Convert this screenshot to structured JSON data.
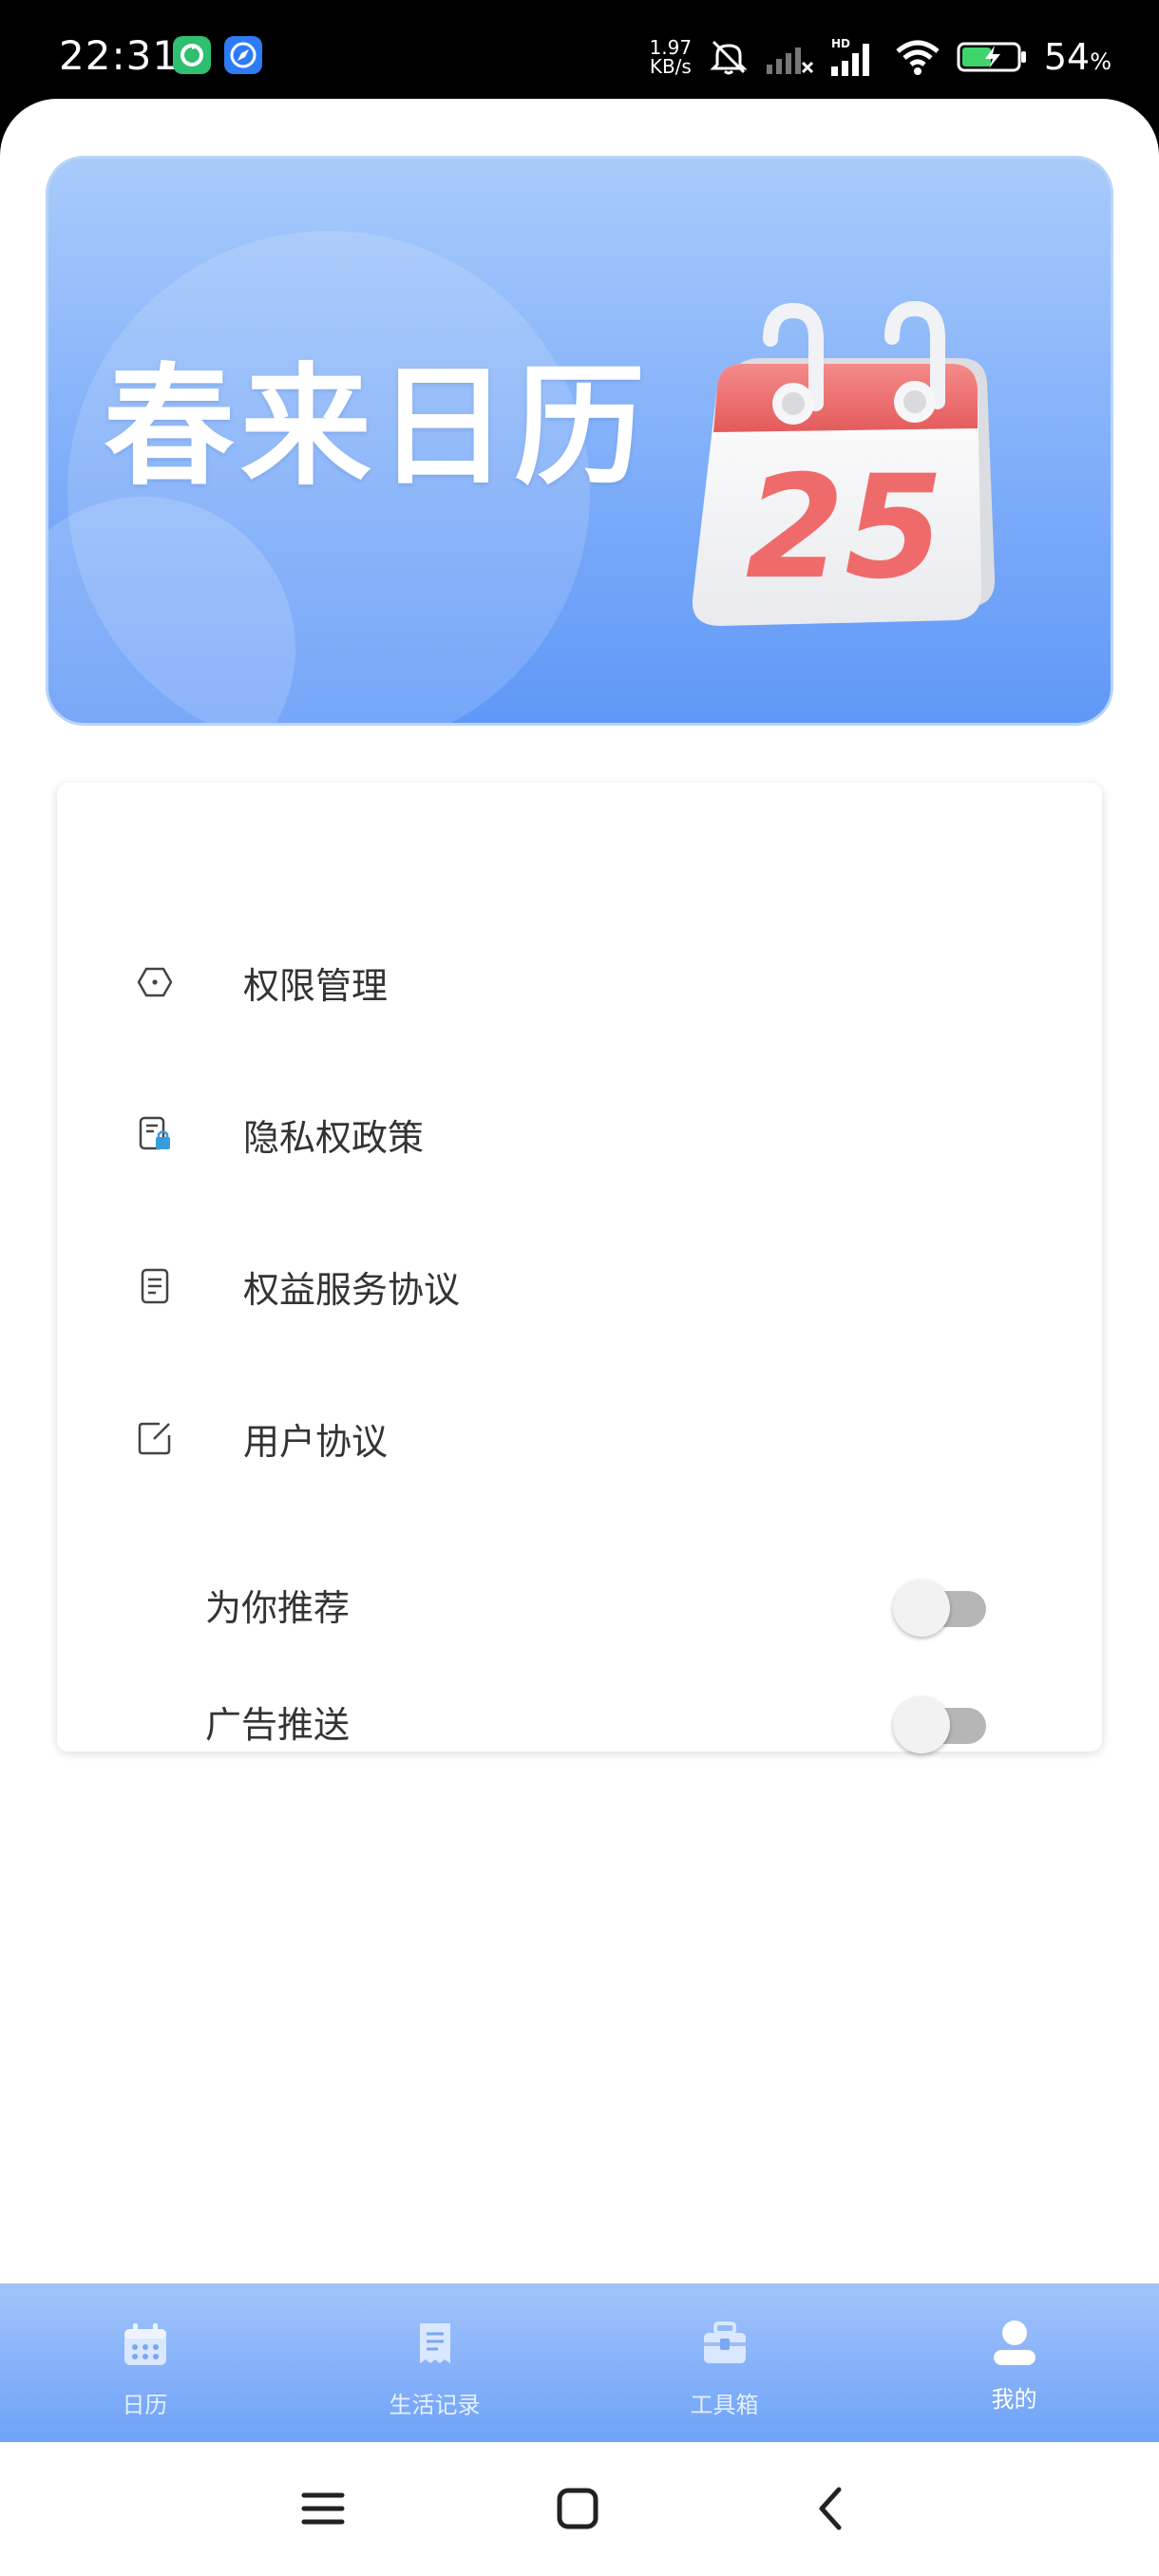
{
  "status_bar": {
    "time": "22:31",
    "net_speed_value": "1.97",
    "net_speed_unit": "KB/s",
    "network_badge": "HD",
    "battery_percent": "54",
    "battery_unit": "%",
    "icons": [
      "app-green-icon",
      "app-compass-icon",
      "mute-icon",
      "signal-weak-icon",
      "signal-hd-icon",
      "wifi-icon",
      "battery-charging-icon"
    ]
  },
  "banner": {
    "title": "春来日历",
    "calendar_day": "25",
    "colors": {
      "gradient_top": "#a9cbfb",
      "gradient_bottom": "#6098f7",
      "calendar_red": "#ef6b6b"
    }
  },
  "menu": {
    "items": [
      {
        "label": "权限管理",
        "icon": "hexagon-dot-icon"
      },
      {
        "label": "隐私权政策",
        "icon": "privacy-lock-doc-icon"
      },
      {
        "label": "权益服务协议",
        "icon": "document-icon"
      },
      {
        "label": "用户协议",
        "icon": "edit-square-icon"
      }
    ],
    "toggles": [
      {
        "label": "为你推荐",
        "on": false
      },
      {
        "label": "广告推送",
        "on": false
      }
    ]
  },
  "bottom_nav": {
    "items": [
      {
        "label": "日历",
        "icon": "calendar-icon"
      },
      {
        "label": "生活记录",
        "icon": "receipt-icon"
      },
      {
        "label": "工具箱",
        "icon": "toolbox-icon"
      },
      {
        "label": "我的",
        "icon": "user-icon",
        "active": true
      }
    ]
  },
  "system_nav": {
    "buttons": [
      "menu-icon",
      "home-icon",
      "back-icon"
    ]
  }
}
